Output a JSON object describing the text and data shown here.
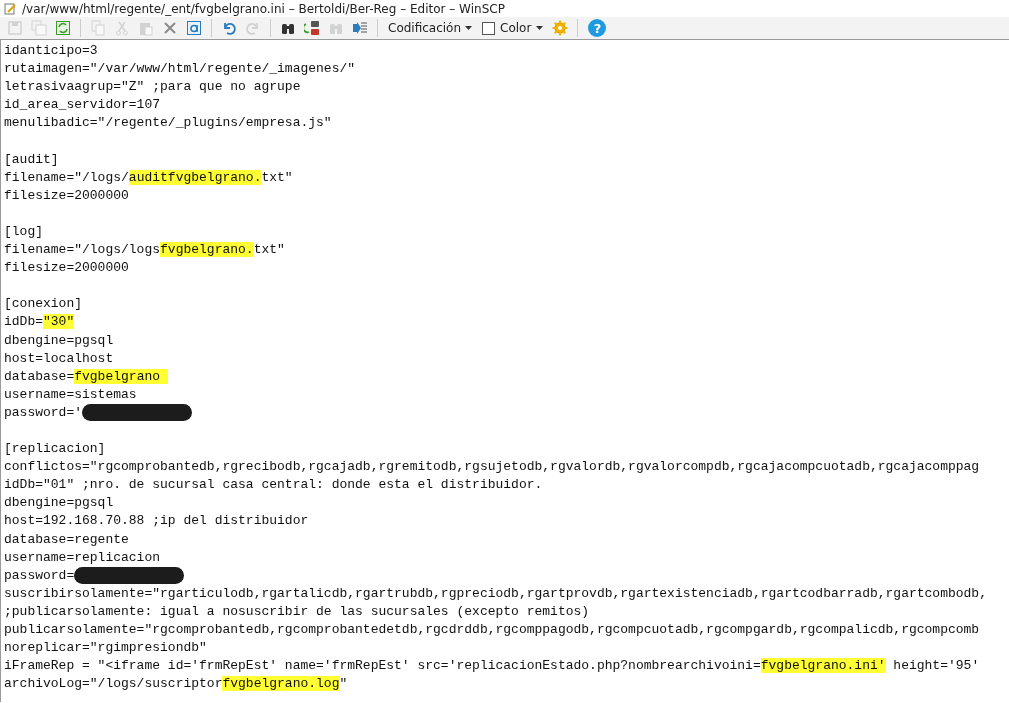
{
  "window": {
    "title": "/var/www/html/regente/_ent/fvgbelgrano.ini – Bertoldi/Ber-Reg – Editor – WinSCP"
  },
  "toolbar": [
    {
      "kind": "save",
      "disabled": true
    },
    {
      "kind": "save-all",
      "disabled": true
    },
    {
      "kind": "reload",
      "disabled": false
    },
    {
      "kind": "separator"
    },
    {
      "kind": "copy",
      "disabled": true
    },
    {
      "kind": "cut",
      "disabled": true
    },
    {
      "kind": "paste",
      "disabled": true
    },
    {
      "kind": "delete",
      "disabled": false
    },
    {
      "kind": "select-all",
      "disabled": false
    },
    {
      "kind": "separator"
    },
    {
      "kind": "undo",
      "disabled": false
    },
    {
      "kind": "redo",
      "disabled": true
    },
    {
      "kind": "separator"
    },
    {
      "kind": "find",
      "disabled": false
    },
    {
      "kind": "replace",
      "disabled": false
    },
    {
      "kind": "find-next",
      "disabled": true
    },
    {
      "kind": "goto-line",
      "disabled": false
    },
    {
      "kind": "separator"
    },
    {
      "kind": "dropdown",
      "label": "Codificación"
    },
    {
      "kind": "checkbox",
      "label": "Color",
      "checked": false
    },
    {
      "kind": "settings",
      "disabled": false
    },
    {
      "kind": "separator"
    },
    {
      "kind": "help",
      "glyph": "?"
    }
  ],
  "lines": [
    {
      "kind": "code",
      "segments": [
        {
          "kind": "plain",
          "text": "idanticipo=3"
        }
      ]
    },
    {
      "kind": "code",
      "segments": [
        {
          "kind": "plain",
          "text": "rutaimagen=\"/var/www/html/regente/_imagenes/\""
        }
      ]
    },
    {
      "kind": "code",
      "segments": [
        {
          "kind": "plain",
          "text": "letrasivaagrup=\"Z\" ;para que no agrupe"
        }
      ]
    },
    {
      "kind": "code",
      "segments": [
        {
          "kind": "plain",
          "text": "id_area_servidor=107"
        }
      ]
    },
    {
      "kind": "code",
      "segments": [
        {
          "kind": "plain",
          "text": "menulibadic=\"/regente/_plugins/empresa.js\""
        }
      ]
    },
    {
      "kind": "blank"
    },
    {
      "kind": "code",
      "segments": [
        {
          "kind": "plain",
          "text": "[audit]"
        }
      ]
    },
    {
      "kind": "code",
      "segments": [
        {
          "kind": "plain",
          "text": "filename=\"/logs/"
        },
        {
          "kind": "highlight",
          "text": "auditfvgbelgrano."
        },
        {
          "kind": "plain",
          "text": "txt\""
        }
      ]
    },
    {
      "kind": "code",
      "segments": [
        {
          "kind": "plain",
          "text": "filesize=2000000"
        }
      ]
    },
    {
      "kind": "blank"
    },
    {
      "kind": "code",
      "segments": [
        {
          "kind": "plain",
          "text": "[log]"
        }
      ]
    },
    {
      "kind": "code",
      "segments": [
        {
          "kind": "plain",
          "text": "filename=\"/logs/logs"
        },
        {
          "kind": "highlight",
          "text": "fvgbelgrano."
        },
        {
          "kind": "plain",
          "text": "txt\""
        }
      ]
    },
    {
      "kind": "code",
      "segments": [
        {
          "kind": "plain",
          "text": "filesize=2000000"
        }
      ]
    },
    {
      "kind": "blank"
    },
    {
      "kind": "code",
      "segments": [
        {
          "kind": "plain",
          "text": "[conexion]"
        }
      ]
    },
    {
      "kind": "code",
      "segments": [
        {
          "kind": "plain",
          "text": "idDb="
        },
        {
          "kind": "highlight",
          "text": "\"30\""
        }
      ]
    },
    {
      "kind": "code",
      "segments": [
        {
          "kind": "plain",
          "text": "dbengine=pgsql"
        }
      ]
    },
    {
      "kind": "code",
      "segments": [
        {
          "kind": "plain",
          "text": "host=localhost"
        }
      ]
    },
    {
      "kind": "code",
      "segments": [
        {
          "kind": "plain",
          "text": "database="
        },
        {
          "kind": "highlight",
          "text": "fvgbelgrano "
        }
      ]
    },
    {
      "kind": "code",
      "segments": [
        {
          "kind": "plain",
          "text": "username=sistemas"
        }
      ]
    },
    {
      "kind": "code",
      "segments": [
        {
          "kind": "plain",
          "text": "password='"
        },
        {
          "kind": "redaction"
        }
      ]
    },
    {
      "kind": "blank"
    },
    {
      "kind": "code",
      "segments": [
        {
          "kind": "plain",
          "text": "[replicacion]"
        }
      ]
    },
    {
      "kind": "code",
      "segments": [
        {
          "kind": "plain",
          "text": "conflictos=\"rgcomprobantedb,rgrecibodb,rgcajadb,rgremitodb,rgsujetodb,rgvalordb,rgvalorcompdb,rgcajacompcuotadb,rgcajacomppag"
        }
      ]
    },
    {
      "kind": "code",
      "segments": [
        {
          "kind": "plain",
          "text": "idDb=\"01\" ;nro. de sucursal casa central: donde esta el distribuidor."
        }
      ]
    },
    {
      "kind": "code",
      "segments": [
        {
          "kind": "plain",
          "text": "dbengine=pgsql"
        }
      ]
    },
    {
      "kind": "code",
      "segments": [
        {
          "kind": "plain",
          "text": "host=192.168.70.88 ;ip del distribuidor"
        }
      ]
    },
    {
      "kind": "code",
      "segments": [
        {
          "kind": "plain",
          "text": "database=regente"
        }
      ]
    },
    {
      "kind": "code",
      "segments": [
        {
          "kind": "plain",
          "text": "username=replicacion"
        }
      ]
    },
    {
      "kind": "code",
      "segments": [
        {
          "kind": "plain",
          "text": "password="
        },
        {
          "kind": "redaction"
        }
      ]
    },
    {
      "kind": "code",
      "segments": [
        {
          "kind": "plain",
          "text": "suscribirsolamente=\"rgarticulodb,rgartalicdb,rgartrubdb,rgpreciodb,rgartprovdb,rgartexistenciadb,rgartcodbarradb,rgartcombodb,"
        }
      ]
    },
    {
      "kind": "code",
      "segments": [
        {
          "kind": "plain",
          "text": ";publicarsolamente: igual a nosuscribir de las sucursales (excepto remitos)"
        }
      ]
    },
    {
      "kind": "code",
      "segments": [
        {
          "kind": "plain",
          "text": "publicarsolamente=\"rgcomprobantedb,rgcomprobantedetdb,rgcdrddb,rgcomppagodb,rgcompcuotadb,rgcompgardb,rgcompalicdb,rgcompcomb"
        }
      ]
    },
    {
      "kind": "code",
      "segments": [
        {
          "kind": "plain",
          "text": "noreplicar=\"rgimpresiondb\""
        }
      ]
    },
    {
      "kind": "code",
      "segments": [
        {
          "kind": "plain",
          "text": "iFrameRep = \"<iframe id='frmRepEst' name='frmRepEst' src='replicacionEstado.php?nombrearchivoini="
        },
        {
          "kind": "highlight",
          "text": "fvgbelgrano.ini'"
        },
        {
          "kind": "plain",
          "text": " height='95'"
        }
      ]
    },
    {
      "kind": "code",
      "segments": [
        {
          "kind": "plain",
          "text": "archivoLog=\"/logs/suscriptor"
        },
        {
          "kind": "highlight",
          "text": "fvgbelgrano.log"
        },
        {
          "kind": "plain",
          "text": "\""
        }
      ]
    }
  ]
}
